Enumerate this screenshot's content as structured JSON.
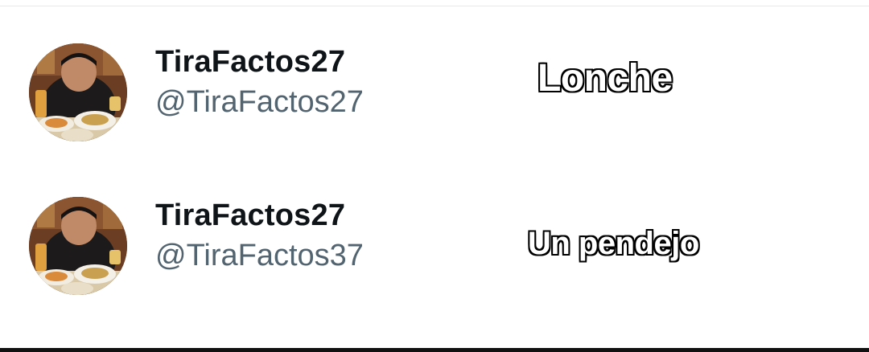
{
  "accounts": [
    {
      "display_name": "TiraFactos27",
      "handle": "@TiraFactos27",
      "caption": "Lonche",
      "avatar_icon": "profile-photo"
    },
    {
      "display_name": "TiraFactos27",
      "handle": "@TiraFactos37",
      "caption": "Un pendejo",
      "avatar_icon": "profile-photo"
    }
  ],
  "colors": {
    "display_name": "#0f1419",
    "handle": "#536471",
    "caption_fill": "#ffffff",
    "caption_stroke": "#000000",
    "divider": "#e6e9ec",
    "bottom_bar": "#111111"
  }
}
